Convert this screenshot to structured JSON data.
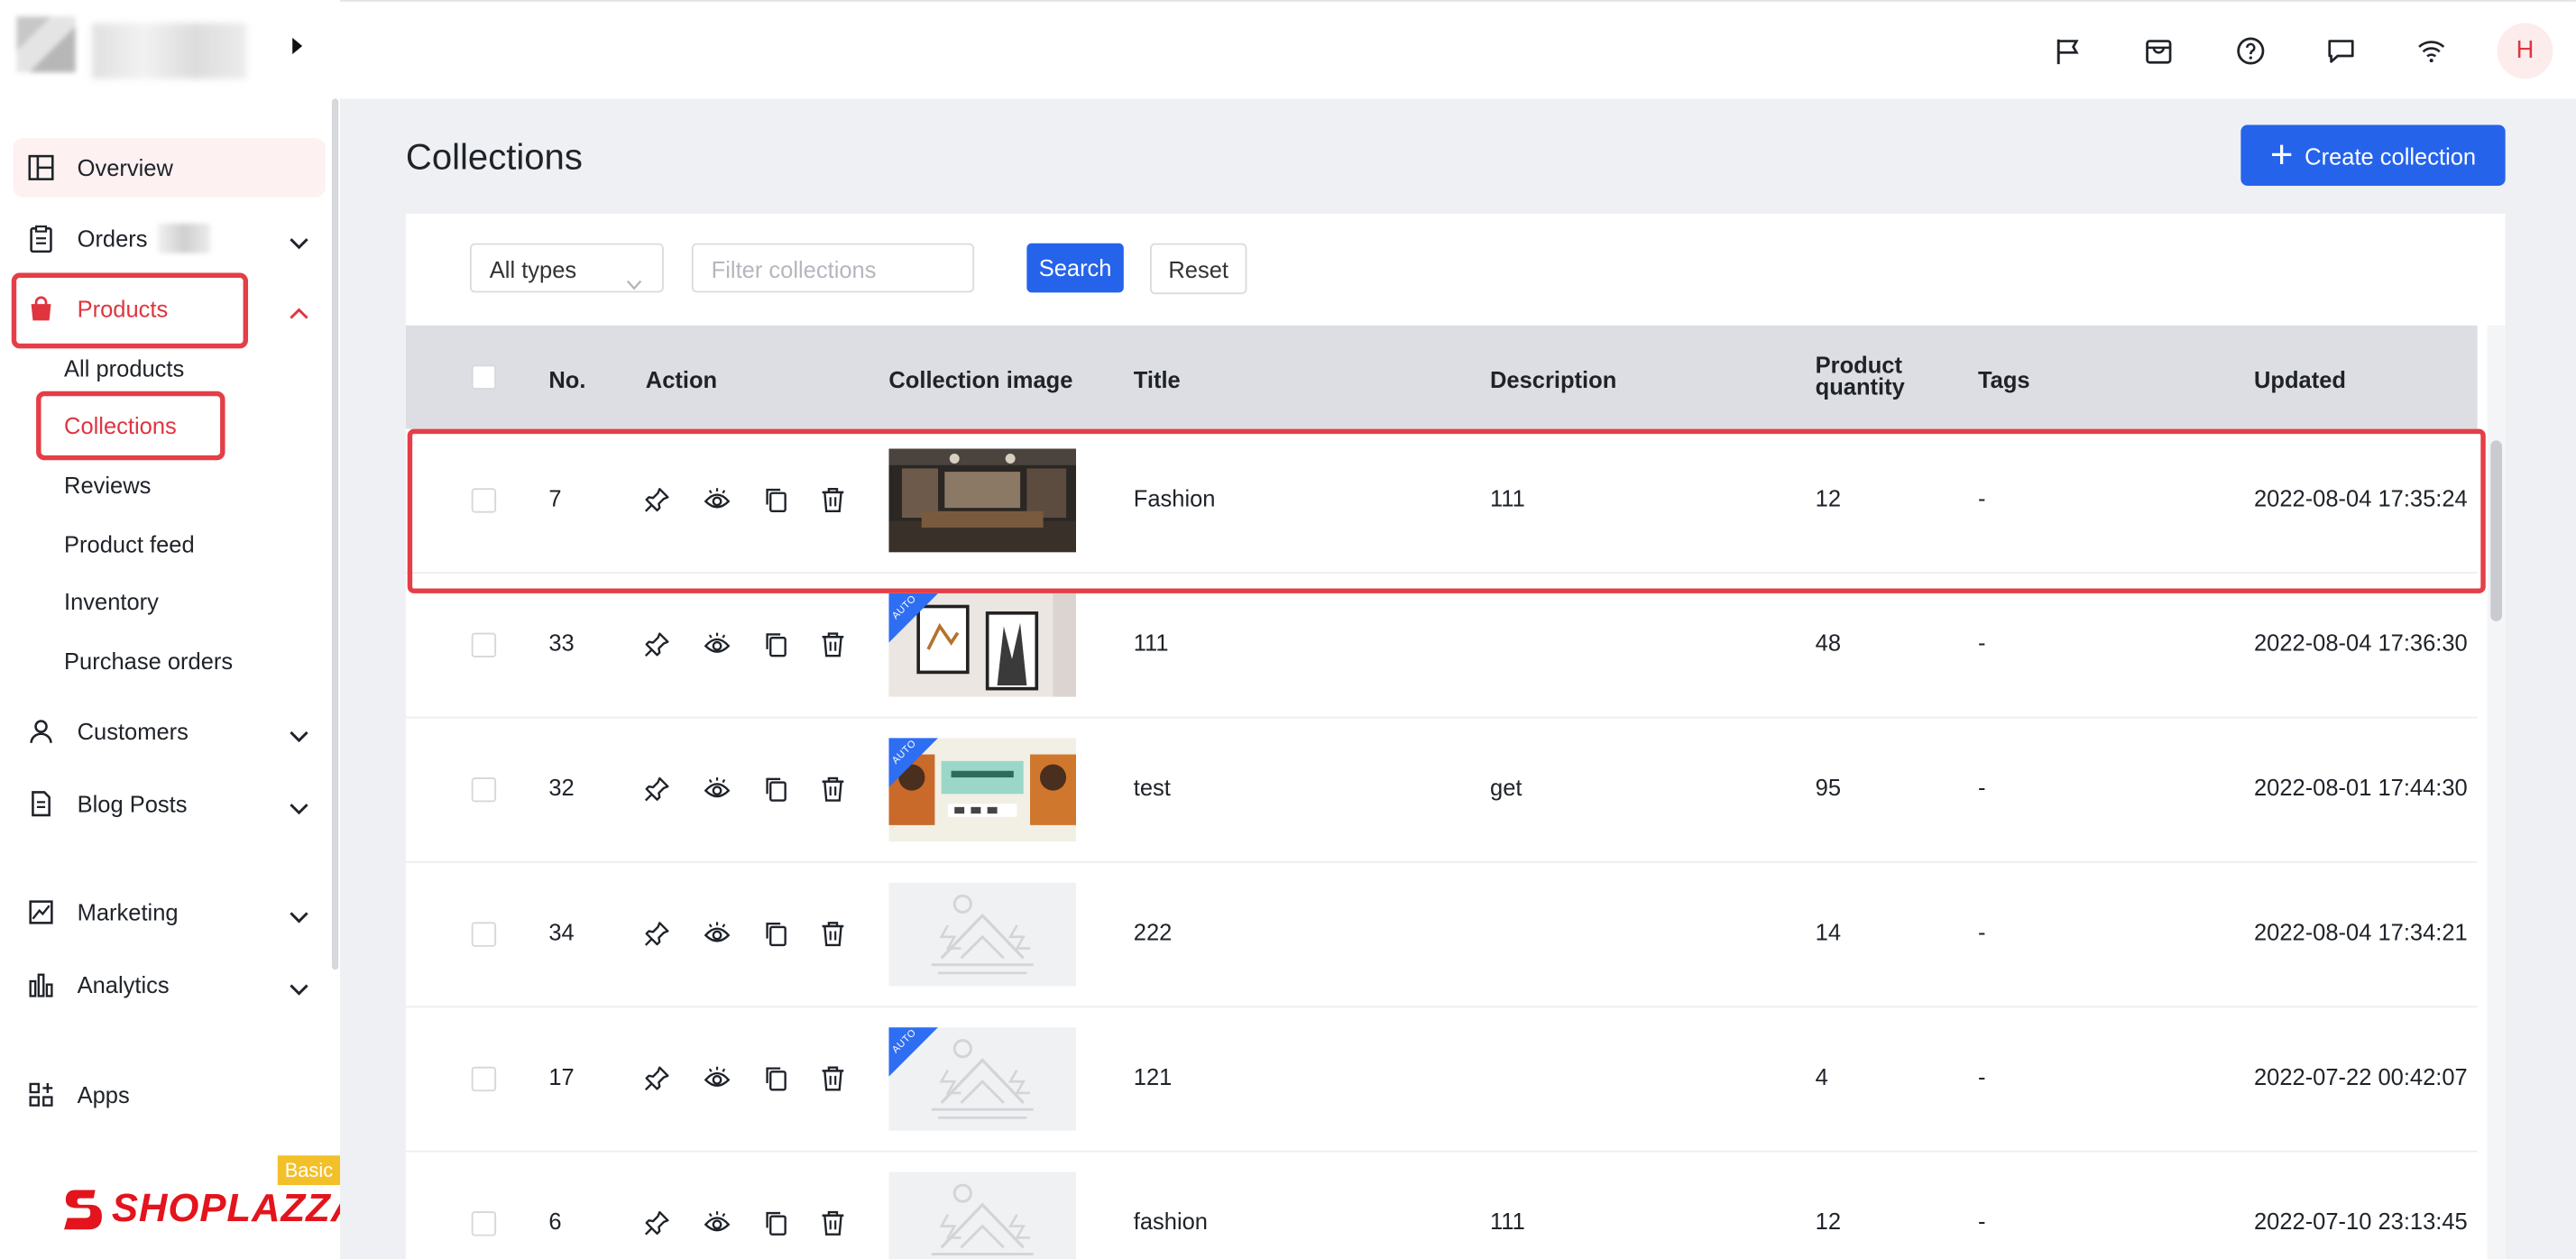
{
  "sidebar": {
    "nav": [
      {
        "label": "Overview",
        "icon": "dashboard-icon"
      },
      {
        "label": "Orders",
        "icon": "orders-clipboard-icon"
      },
      {
        "label": "Products",
        "icon": "shopping-bag-icon"
      },
      {
        "label": "Customers",
        "icon": "person-icon"
      },
      {
        "label": "Blog Posts",
        "icon": "document-icon"
      },
      {
        "label": "Marketing",
        "icon": "marketing-icon"
      },
      {
        "label": "Analytics",
        "icon": "bar-chart-icon"
      },
      {
        "label": "Apps",
        "icon": "apps-grid-icon"
      }
    ],
    "product_sub": [
      "All products",
      "Collections",
      "Reviews",
      "Product feed",
      "Inventory",
      "Purchase orders"
    ],
    "brand": "SHOPLAZZA",
    "plan_badge": "Basic",
    "accent_color": "#e0353f"
  },
  "topbar": {
    "icons": [
      "flag-icon",
      "store-icon",
      "help-icon",
      "chat-icon",
      "wifi-icon"
    ],
    "avatar_letter": "H"
  },
  "page": {
    "title": "Collections",
    "create_button": "Create collection"
  },
  "filters": {
    "type_select": "All types",
    "search_placeholder": "Filter collections",
    "search_button": "Search",
    "reset_button": "Reset"
  },
  "table": {
    "columns": {
      "no": "No.",
      "action": "Action",
      "image": "Collection image",
      "title": "Title",
      "description": "Description",
      "quantity_line1": "Product",
      "quantity_line2": "quantity",
      "tags": "Tags",
      "updated": "Updated"
    },
    "rows": [
      {
        "no": "7",
        "image": "photo-store",
        "auto": false,
        "title": "Fashion",
        "description": "111",
        "quantity": "12",
        "tags": "-",
        "updated": "2022-08-04 17:35:24"
      },
      {
        "no": "33",
        "image": "photo-frames",
        "auto": true,
        "title": "111",
        "description": "",
        "quantity": "48",
        "tags": "-",
        "updated": "2022-08-04 17:36:30"
      },
      {
        "no": "32",
        "image": "photo-banner",
        "auto": true,
        "title": "test",
        "description": "get",
        "quantity": "95",
        "tags": "-",
        "updated": "2022-08-01 17:44:30"
      },
      {
        "no": "34",
        "image": "placeholder",
        "auto": false,
        "title": "222",
        "description": "",
        "quantity": "14",
        "tags": "-",
        "updated": "2022-08-04 17:34:21"
      },
      {
        "no": "17",
        "image": "placeholder",
        "auto": true,
        "title": "121",
        "description": "",
        "quantity": "4",
        "tags": "-",
        "updated": "2022-07-22 00:42:07"
      },
      {
        "no": "6",
        "image": "placeholder",
        "auto": false,
        "title": "fashion",
        "description": "111",
        "quantity": "12",
        "tags": "-",
        "updated": "2022-07-10 23:13:45"
      }
    ],
    "auto_label": "AUTO"
  }
}
